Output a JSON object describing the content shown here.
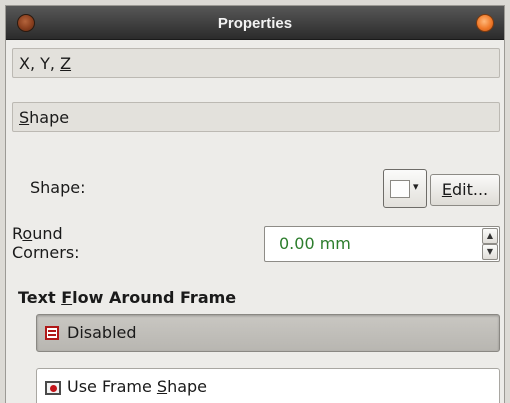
{
  "window": {
    "title": "Properties"
  },
  "sections": [
    {
      "label_pre": "X, Y, ",
      "label_key": "Z",
      "label_post": ""
    },
    {
      "label_pre": "",
      "label_key": "S",
      "label_post": "hape"
    }
  ],
  "shape": {
    "label": "Shape:",
    "edit_pre": "",
    "edit_key": "E",
    "edit_post": "dit..."
  },
  "round_corners": {
    "label_pre": "R",
    "label_key": "o",
    "label_post1": "und",
    "label_line2": "Corners:",
    "value": "0.00 mm"
  },
  "text_flow": {
    "heading_pre": "Text ",
    "heading_key": "F",
    "heading_post": "low Around Frame",
    "options": [
      {
        "label_pre": "Disabled",
        "label_key": "",
        "label_post": "",
        "selected": true
      },
      {
        "label_pre": "Use Frame ",
        "label_key": "S",
        "label_post": "hape",
        "selected": false
      }
    ]
  },
  "colors": {
    "value_text": "#2c7d2c",
    "close_button": "#f07a2a",
    "icon_red": "#b01818"
  },
  "icons": {
    "window_menu": "window-menu-icon",
    "window_close": "window-close-icon",
    "combo_arrow": "chevron-down-icon",
    "spin_up": "chevron-up-icon",
    "spin_down": "chevron-down-icon",
    "flow_disabled": "text-flow-disabled-icon",
    "flow_frame_shape": "text-flow-frame-shape-icon"
  }
}
